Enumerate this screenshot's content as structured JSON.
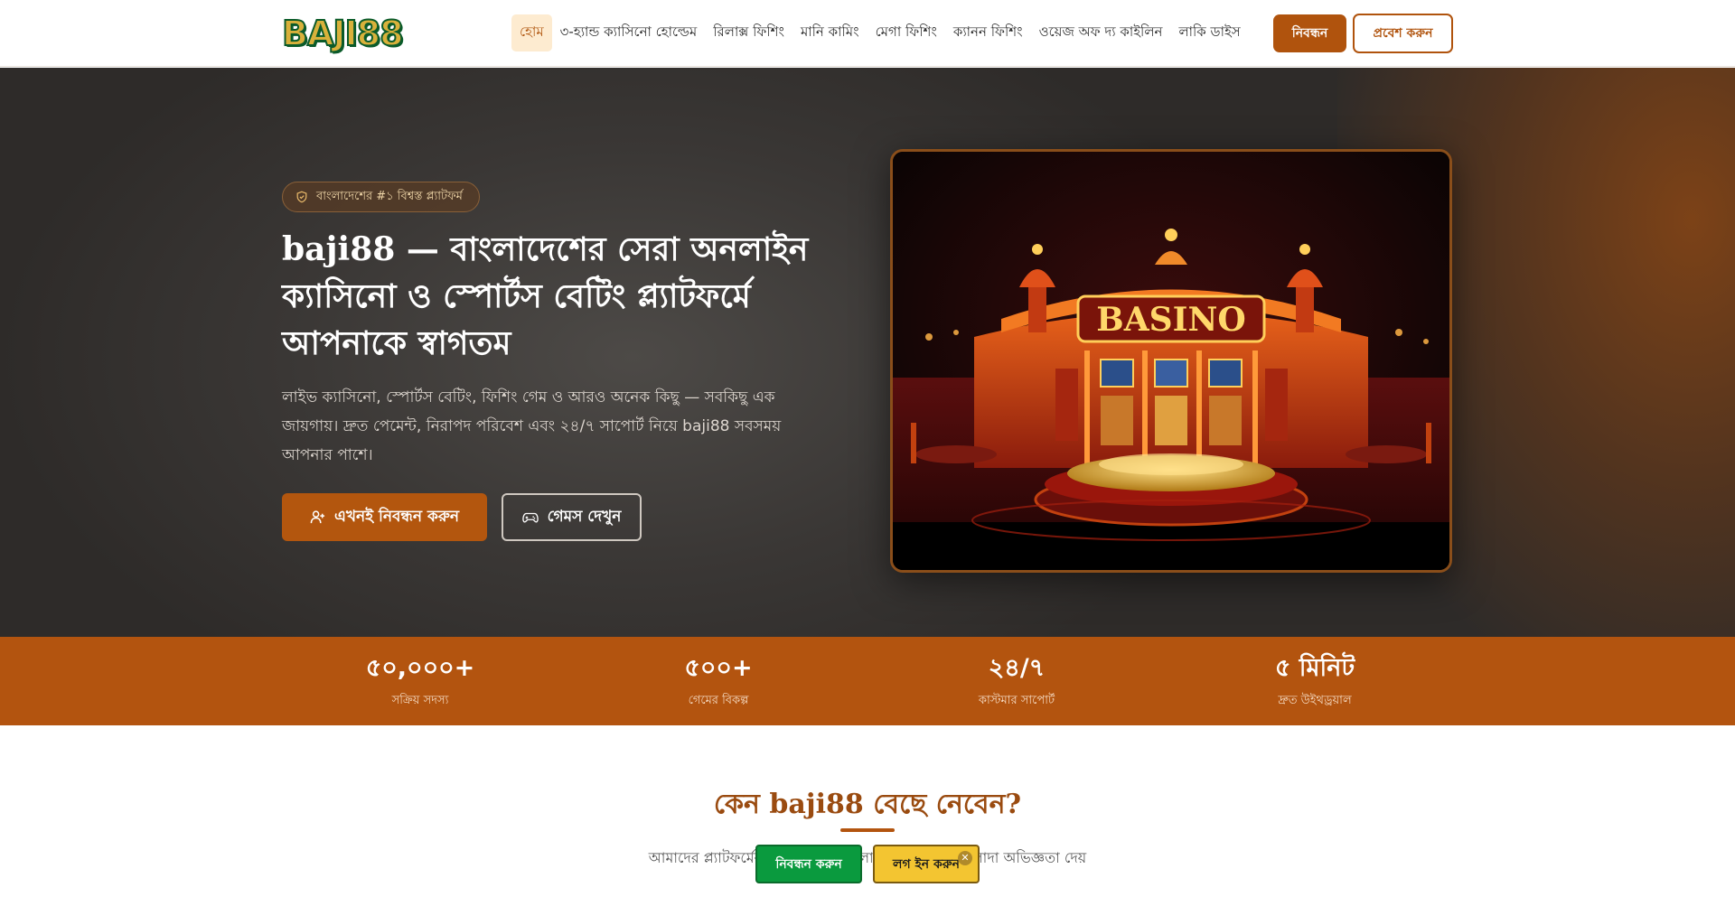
{
  "header": {
    "logo_text": "BAJI88",
    "nav": [
      {
        "label": "হোম",
        "active": true
      },
      {
        "label": "৩-হ্যান্ড ক্যাসিনো হোল্ডেম",
        "active": false
      },
      {
        "label": "রিলাক্স ফিশিং",
        "active": false
      },
      {
        "label": "মানি কামিং",
        "active": false
      },
      {
        "label": "মেগা ফিশিং",
        "active": false
      },
      {
        "label": "ক্যানন ফিশিং",
        "active": false
      },
      {
        "label": "ওয়েজ অফ দ্য কাইলিন",
        "active": false
      },
      {
        "label": "লাকি ডাইস",
        "active": false
      }
    ],
    "register_label": "নিবন্ধন",
    "login_label": "প্রবেশ করুন"
  },
  "hero": {
    "badge_icon": "shield-icon",
    "badge_text": "বাংলাদেশের #১ বিশ্বস্ত প্ল্যাটফর্ম",
    "title": "baji88 — বাংলাদেশের সেরা অনলাইন ক্যাসিনো ও স্পোর্টস বেটিং প্ল্যাটফর্মে আপনাকে স্বাগতম",
    "description": "লাইভ ক্যাসিনো, স্পোর্টস বেটিং, ফিশিং গেম ও আরও অনেক কিছু — সবকিছু এক জায়গায়। দ্রুত পেমেন্ট, নিরাপদ পরিবেশ এবং ২৪/৭ সাপোর্ট নিয়ে baji88 সবসময় আপনার পাশে।",
    "primary_button": "এখনই নিবন্ধন করুন",
    "primary_icon": "user-plus-icon",
    "secondary_button": "গেমস দেখুন",
    "secondary_icon": "gamepad-icon",
    "image_sign": "BASINO"
  },
  "stats": [
    {
      "value": "৫০,০০০+",
      "label": "সক্রিয় সদস্য"
    },
    {
      "value": "৫০০+",
      "label": "গেমের বিকল্প"
    },
    {
      "value": "২৪/৭",
      "label": "কাস্টমার সাপোর্ট"
    },
    {
      "value": "৫ মিনিট",
      "label": "দ্রুত উইথড্রয়াল"
    }
  ],
  "why": {
    "title": "কেন baji88 বেছে নেবেন?",
    "subtitle": "আমাদের প্ল্যাটফর্মের বিশেষ সুবিধাগুলো যা আপনাকে আলাদা অভিজ্ঞতা দেয়"
  },
  "floating": {
    "register_label": "নিবন্ধন করুন",
    "login_label": "লগ ইন করুন",
    "close_symbol": "✕"
  },
  "colors": {
    "accent": "#b3540f",
    "floating_register": "#0a9a3e",
    "floating_login": "#f3c531"
  }
}
